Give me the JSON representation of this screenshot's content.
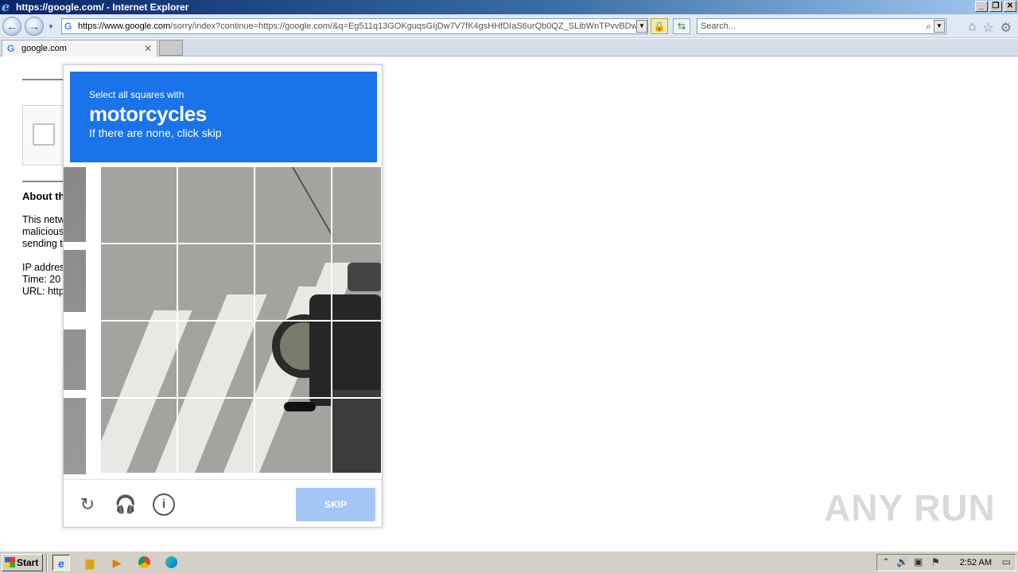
{
  "window": {
    "title": "https://google.com/ - Internet Explorer",
    "buttons": [
      "_",
      "❐",
      "✕"
    ]
  },
  "nav": {
    "back_icon": "back-arrow-icon",
    "forward_icon": "forward-arrow-icon",
    "address_host": "https://www.google.com",
    "address_path": "/sorry/index?continue=https://google.com/&q=Eg511q13GOKguqsGIjDw7V7fK4gsHHfDIaS6urQb0QZ_SLibWnTPvvBDwb",
    "search_placeholder": "Search..."
  },
  "tabs": [
    {
      "label": "google.com"
    }
  ],
  "page": {
    "about_heading": "About th",
    "para_lines": [
      "This netw",
      "malicious",
      "sending t"
    ],
    "info_lines": [
      "IP addres",
      "Time: 20",
      "URL: http"
    ]
  },
  "challenge": {
    "instruction": "Select all squares with",
    "target": "motorcycles",
    "hint": "If there are none, click skip",
    "skip_label": "SKIP",
    "footer_icons": [
      "reload-icon",
      "headphones-icon",
      "info-icon"
    ]
  },
  "watermark": "ANY RUN",
  "taskbar": {
    "start_label": "Start",
    "apps": [
      "internet-explorer-icon",
      "file-explorer-icon",
      "media-player-icon",
      "chrome-icon",
      "edge-icon"
    ],
    "clock": "2:52 AM"
  },
  "colors": {
    "challenge_header": "#1a73e8",
    "skip_button": "#a4c6f4"
  }
}
